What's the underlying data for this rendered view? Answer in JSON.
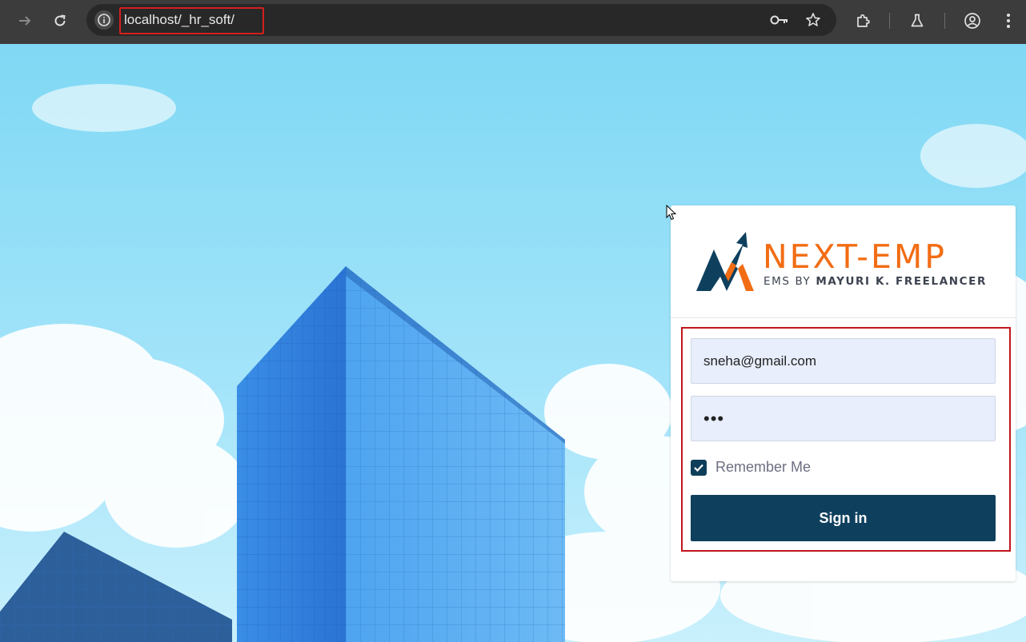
{
  "browser": {
    "url": "localhost/_hr_soft/",
    "icons": [
      "forward-icon",
      "reload-icon",
      "site-info-icon",
      "password-key-icon",
      "bookmark-star-icon",
      "extensions-icon",
      "labs-flask-icon",
      "profile-icon",
      "menu-icon"
    ]
  },
  "brand": {
    "name": "NEXT-EMP",
    "tagline_prefix": "EMS BY ",
    "tagline_bold": "MAYURI K. FREELANCER",
    "colors": {
      "orange": "#f26c13",
      "navy": "#0e405e"
    }
  },
  "login": {
    "email_value": "sneha@gmail.com",
    "password_value": "•••",
    "remember_label": "Remember Me",
    "remember_checked": true,
    "signin_label": "Sign in"
  },
  "colors": {
    "highlight_red": "#c0161c",
    "button_bg": "#0e405e",
    "field_bg": "#e8eefc"
  }
}
